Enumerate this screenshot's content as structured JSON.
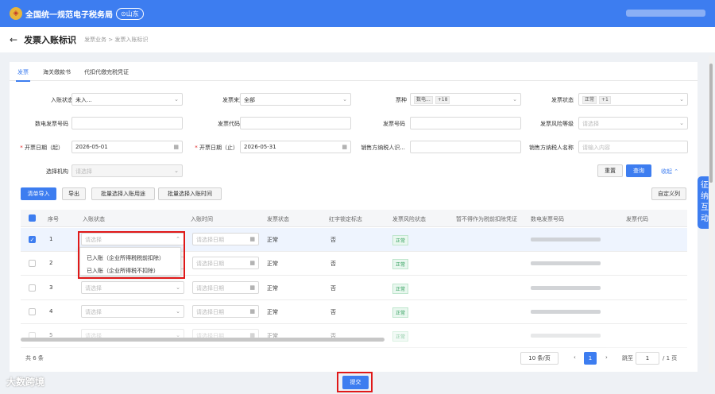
{
  "header": {
    "logo_glyph": "◈",
    "title": "全国统一规范电子税务局",
    "region": "⊙山东"
  },
  "titlebar": {
    "back_icon": "←",
    "page_title": "发票入账标识",
    "breadcrumb": "发票业务 > 发票入账标识"
  },
  "tabs": [
    "发票",
    "海关缴款书",
    "代扣代缴完税凭证"
  ],
  "filters": {
    "entry_status": {
      "label": "入账状态",
      "value": "未入..."
    },
    "invoice_source": {
      "label": "发票来源",
      "value": "全部"
    },
    "ticket_type": {
      "label": "票种",
      "tag": "数电...",
      "more": "+18"
    },
    "invoice_status": {
      "label": "发票状态",
      "tag": "正常",
      "more": "+1"
    },
    "digital_invoice_no": {
      "label": "数电发票号码"
    },
    "invoice_code": {
      "label": "发票代码"
    },
    "invoice_no": {
      "label": "发票号码"
    },
    "risk_level": {
      "label": "发票风险等级",
      "placeholder": "请选择"
    },
    "date_start": {
      "label": "开票日期（起）",
      "value": "2026-05-01"
    },
    "date_end": {
      "label": "开票日期（止）",
      "value": "2026-05-31"
    },
    "seller_tax_id": {
      "label": "销售方纳税人识..."
    },
    "seller_name": {
      "label": "销售方纳税人名称",
      "placeholder": "请输入内容"
    },
    "org": {
      "label": "选择机构",
      "placeholder": "请选择"
    },
    "reset": "重置",
    "search": "查询",
    "collapse": "收起 ⌃"
  },
  "toolbar": {
    "list_import": "清单导入",
    "export": "导出",
    "batch_purpose": "批量选择入账用途",
    "batch_time": "批量选择入账时间",
    "custom_columns": "自定义列"
  },
  "table": {
    "headers": [
      "序号",
      "入账状态",
      "入账时间",
      "发票状态",
      "红字锁定标志",
      "发票风险状态",
      "暂不得作为税前扣除凭证",
      "数电发票号码",
      "发票代码"
    ],
    "rows": [
      {
        "no": "1",
        "status_placeholder": "请选择",
        "date_placeholder": "请选择日期",
        "invoice_status": "正常",
        "red_lock": "否",
        "risk": "正常",
        "checked": true
      },
      {
        "no": "2",
        "status_placeholder": "请选择",
        "date_placeholder": "请选择日期",
        "invoice_status": "正常",
        "red_lock": "否",
        "risk": "正常",
        "checked": false
      },
      {
        "no": "3",
        "status_placeholder": "请选择",
        "date_placeholder": "请选择日期",
        "invoice_status": "正常",
        "red_lock": "否",
        "risk": "正常",
        "checked": false
      },
      {
        "no": "4",
        "status_placeholder": "请选择",
        "date_placeholder": "请选择日期",
        "invoice_status": "正常",
        "red_lock": "否",
        "risk": "正常",
        "checked": false
      },
      {
        "no": "5",
        "status_placeholder": "请选择",
        "date_placeholder": "请选择日期",
        "invoice_status": "正常",
        "red_lock": "否",
        "risk": "正常",
        "checked": false
      }
    ],
    "dropdown_options": [
      "已入账（企业所得税税前扣除）",
      "已入账（企业所得税不扣除）"
    ]
  },
  "pagination": {
    "total": "共 6 条",
    "page_size": "10 条/页",
    "current": "1",
    "goto_label": "跳至",
    "goto_value": "1",
    "total_pages": "/ 1 页",
    "prev": "‹",
    "next": "›"
  },
  "submit": "提交",
  "float_panel": "征纳互动",
  "watermark": "大数跨境"
}
